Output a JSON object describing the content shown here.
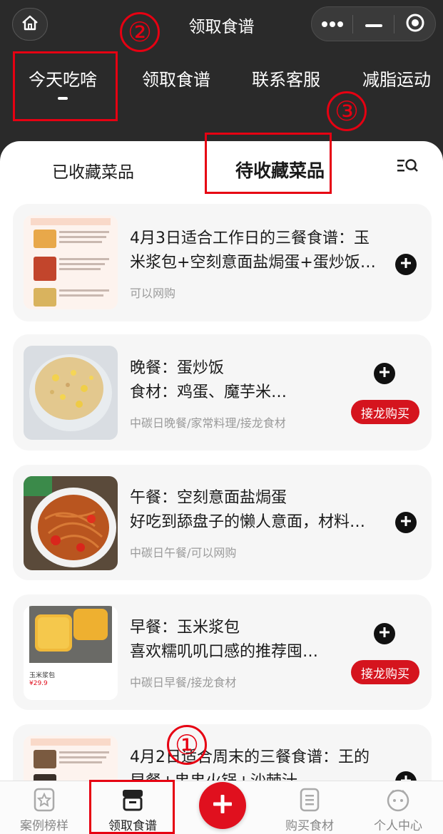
{
  "header": {
    "title": "领取食谱",
    "home_icon": "home-icon",
    "capsule": {
      "more_icon": "more-dots-icon",
      "minimize_icon": "minimize-icon",
      "close_icon": "target-close-icon"
    }
  },
  "top_tabs": [
    {
      "label": "今天吃啥",
      "active": true
    },
    {
      "label": "领取食谱",
      "active": false
    },
    {
      "label": "联系客服",
      "active": false
    },
    {
      "label": "减脂运动",
      "active": false
    }
  ],
  "sub_tabs": [
    {
      "label": "已收藏菜品",
      "active": false
    },
    {
      "label": "待收藏菜品",
      "active": true
    }
  ],
  "filter_icon": "search-filter-icon",
  "annotations": {
    "one": "①",
    "two": "②",
    "three": "③"
  },
  "cards": [
    {
      "line1": "4月3日适合工作日的三餐食谱：玉",
      "line2": "米浆包+空刻意面盐焗蛋+蛋炒饭…",
      "meta": "可以网购",
      "has_buy": false,
      "thumb": "menu-sheet"
    },
    {
      "line1": "晚餐：蛋炒饭",
      "line2": "食材：鸡蛋、魔芋米…",
      "meta": "中碳日晚餐/家常料理/接龙食材",
      "has_buy": true,
      "thumb": "fried-rice"
    },
    {
      "line1": "午餐：空刻意面盐焗蛋",
      "line2": "好吃到舔盘子的懒人意面，材料…",
      "meta": "中碳日午餐/可以网购",
      "has_buy": false,
      "thumb": "pasta"
    },
    {
      "line1": "早餐：玉米浆包",
      "line2": "喜欢糯叽叽口感的推荐囤…",
      "meta": "中碳日早餐/接龙食材",
      "has_buy": true,
      "thumb": "corn-bun",
      "thumb_label": "玉米浆包",
      "thumb_price": "¥29.9"
    },
    {
      "line1": "4月2日适合周末的三餐食谱：王的",
      "line2": "早餐+串串火锅+沙棘汁",
      "meta": "",
      "has_buy": false,
      "thumb": "menu-sheet"
    }
  ],
  "buy_label": "接龙购买",
  "bottom_nav": [
    {
      "label": "案例榜样",
      "icon": "star-badge-icon",
      "active": false
    },
    {
      "label": "领取食谱",
      "icon": "recipe-box-icon",
      "active": true
    },
    {
      "label": "购买食材",
      "icon": "list-document-icon",
      "active": false
    },
    {
      "label": "个人中心",
      "icon": "profile-face-icon",
      "active": false
    }
  ],
  "center_action_icon": "add-plus-icon",
  "colors": {
    "header_bg": "#2a2a2a",
    "accent_red": "#e0101e",
    "card_bg": "#f6f6f6",
    "annotation_red": "#e60012"
  }
}
